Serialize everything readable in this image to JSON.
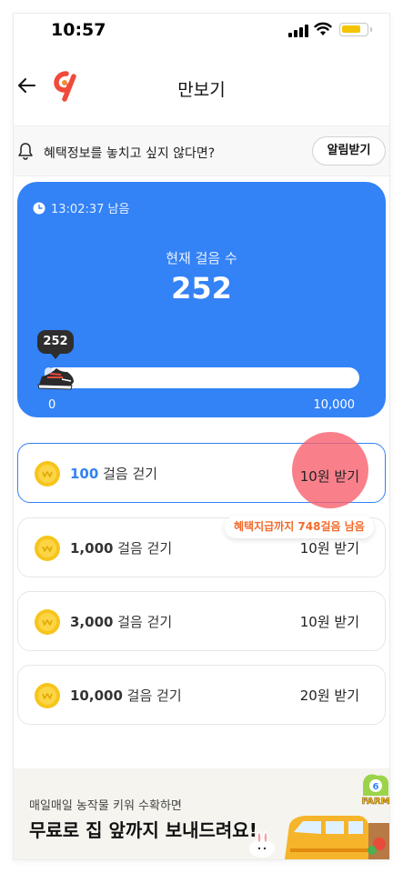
{
  "status_bar": {
    "time": "10:57"
  },
  "nav": {
    "title": "만보기"
  },
  "notify": {
    "text": "혜택정보를 놓치고 싶지 않다면?",
    "button": "알림받기"
  },
  "step_card": {
    "timer": "13:02:37 남음",
    "label": "현재 걸음 수",
    "steps": "252",
    "bubble": "252",
    "progress": 0.0252,
    "min": "0",
    "max": "10,000"
  },
  "missions": [
    {
      "count": "100",
      "suffix": " 걸음 걷기",
      "reward": "10원 받기",
      "active": true
    },
    {
      "count": "1,000",
      "suffix": " 걸음 걷기",
      "reward": "10원 받기",
      "active": false
    },
    {
      "count": "3,000",
      "suffix": " 걸음 걷기",
      "reward": "10원 받기",
      "active": false
    },
    {
      "count": "10,000",
      "suffix": " 걸음 걷기",
      "reward": "20원 받기",
      "active": false
    }
  ],
  "hint": "혜택지급까지 748걸음 남음",
  "banner": {
    "sub": "매일매일 농작물 키워 수확하면",
    "title": "무료로 집 앞까지 보내드려요!",
    "art_text": "FARM"
  },
  "colors": {
    "accent": "#3382f6",
    "highlight": "#f7606e",
    "hint": "#f26b2b"
  }
}
